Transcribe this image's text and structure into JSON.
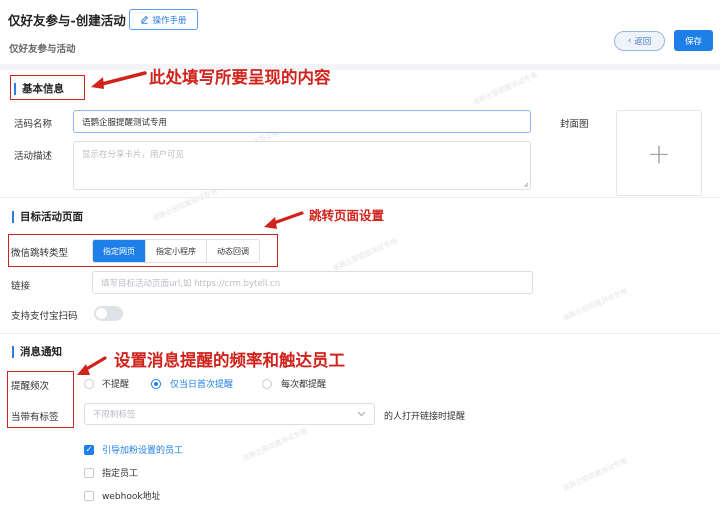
{
  "header": {
    "title": "仅好友参与-创建活动",
    "manual_button": "操作手册",
    "subtitle": "仅好友参与活动",
    "back_button": "返回",
    "save_button": "保存"
  },
  "basic_info": {
    "section_title": "基本信息",
    "name_label": "活码名称",
    "name_value": "语鹦企服提醒测试专用",
    "desc_label": "活动描述",
    "desc_placeholder": "显示在分享卡片，用户可见",
    "cover_label": "封面图",
    "cover_plus": "+"
  },
  "target_page": {
    "section_title": "目标活动页面",
    "jump_type_label": "微信跳转类型",
    "jump_options": [
      "指定网页",
      "指定小程序",
      "动态回调"
    ],
    "link_label": "链接",
    "link_placeholder": "填写目标活动页面url,如 https://crm.bytell.cn",
    "alipay_label": "支持支付宝扫码"
  },
  "notification": {
    "section_title": "消息通知",
    "frequency_label": "提醒频次",
    "frequency_options": [
      "不提醒",
      "仅当日首次提醒",
      "每次都提醒"
    ],
    "tag_label": "当带有标签",
    "tag_placeholder": "不限制标签",
    "tag_suffix": "的人打开链接时提醒",
    "recipients": [
      {
        "label": "引导加粉设置的员工",
        "checked": true
      },
      {
        "label": "指定员工",
        "checked": false
      },
      {
        "label": "webhook地址",
        "checked": false
      }
    ]
  },
  "annotations": {
    "basic_info_note": "此处填写所要呈现的内容",
    "jump_note": "跳转页面设置",
    "notify_note": "设置消息提醒的频率和触达员工"
  },
  "watermark_text": "语鹦企服提醒测试专用",
  "colors": {
    "primary": "#1e7fe8",
    "annotation_red": "#d0231c",
    "section_bar": "#2a7de1"
  }
}
